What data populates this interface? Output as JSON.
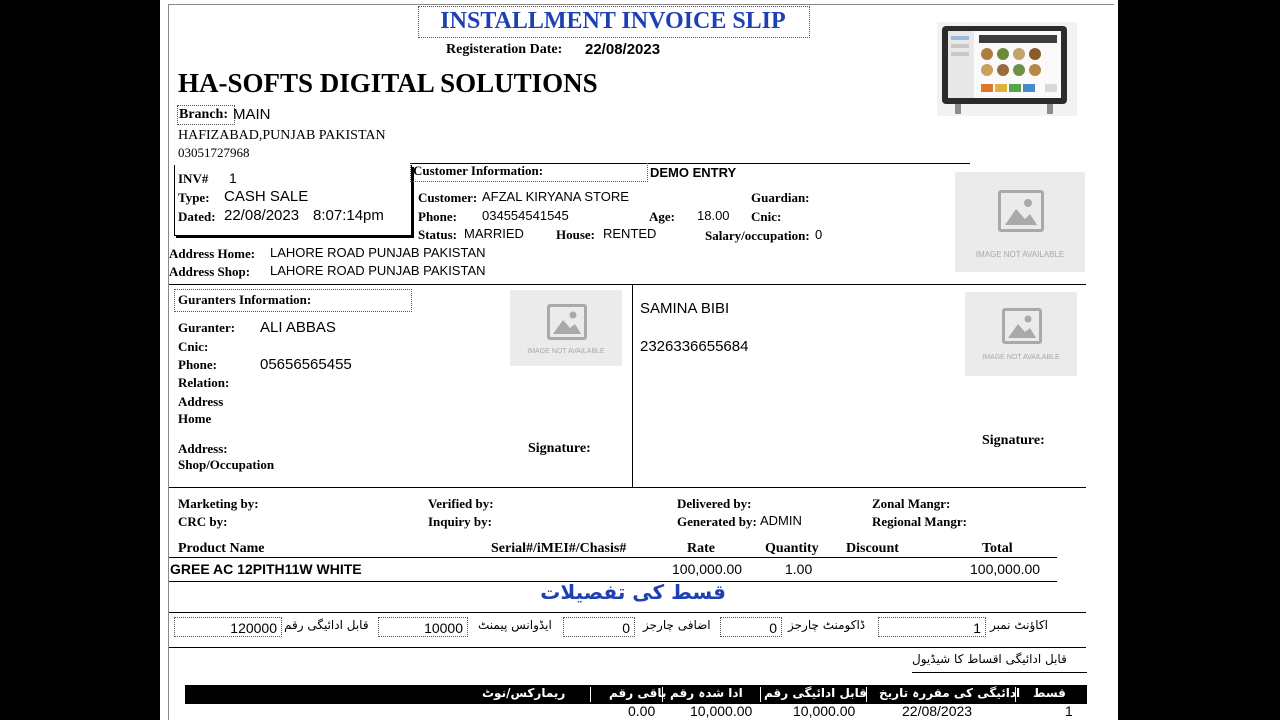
{
  "slip": {
    "title": "INSTALLMENT INVOICE SLIP",
    "reg_date_label": "Registeration Date:",
    "reg_date": "22/08/2023"
  },
  "company": {
    "name": "HA-SOFTS DIGITAL SOLUTIONS",
    "branch_label": "Branch:",
    "branch": "MAIN",
    "address": "HAFIZABAD,PUNJAB PAKISTAN",
    "phone": "03051727968"
  },
  "invoice": {
    "inv_label": "INV#",
    "inv_no": "1",
    "type_label": "Type:",
    "type": "CASH SALE",
    "dated_label": "Dated:",
    "dated": "22/08/2023",
    "time": "8:07:14pm"
  },
  "customer": {
    "section_label": "Customer Information:",
    "demo": "DEMO ENTRY",
    "customer_label": "Customer:",
    "customer": "AFZAL KIRYANA STORE",
    "phone_label": "Phone:",
    "phone": "034554541545",
    "age_label": "Age:",
    "age": "18.00",
    "status_label": "Status:",
    "status": "MARRIED",
    "house_label": "House:",
    "house": "RENTED",
    "guardian_label": "Guardian:",
    "cnic_label": "Cnic:",
    "salary_label": "Salary/occupation:",
    "salary": "0",
    "address_home_label": "Address Home:",
    "address_home": "LAHORE ROAD PUNJAB PAKISTAN",
    "address_shop_label": "Address Shop:",
    "address_shop": "LAHORE ROAD PUNJAB PAKISTAN"
  },
  "image_placeholder_text": "IMAGE NOT AVAILABLE",
  "guarantor": {
    "section_label": "Guranters Information:",
    "name_label": "Guranter:",
    "name": "ALI ABBAS",
    "cnic_label": "Cnic:",
    "phone_label": "Phone:",
    "phone": "05656565455",
    "relation_label": "Relation:",
    "address_home_label_1": "Address",
    "address_home_label_2": "Home",
    "address_shop_label_1": "Address:",
    "address_shop_label_2": "Shop/Occupation",
    "signature_label": "Signature:"
  },
  "guarantor2": {
    "name": "SAMINA BIBI",
    "cnic": "2326336655684",
    "signature_label": "Signature:"
  },
  "staff": {
    "marketing_label": "Marketing by:",
    "crc_label": "CRC by:",
    "verified_label": "Verified by:",
    "inquiry_label": "Inquiry  by:",
    "delivered_label": "Delivered by:",
    "generated_label": "Generated by:",
    "generated": "ADMIN",
    "zonal_label": "Zonal Mangr:",
    "regional_label": "Regional Mangr:"
  },
  "products": {
    "headers": [
      "Product Name",
      "Serial#/iMEI#/Chasis#",
      "Rate",
      "Quantity",
      "Discount",
      "Total"
    ],
    "rows": [
      {
        "name": "GREE AC 12PITH11W WHITE",
        "serial": "",
        "rate": "100,000.00",
        "qty": "1.00",
        "discount": "",
        "total": "100,000.00"
      }
    ]
  },
  "installment": {
    "heading": "قسط کی تفصیلات",
    "account_label": "اکاؤنٹ نمبر",
    "account": "1",
    "doc_charges_label": "ڈاکومنٹ چارجز",
    "doc_charges": "0",
    "extra_charges_label": "اضافی چارجز",
    "extra_charges": "0",
    "advance_label": "ایڈوانس پیمنٹ",
    "advance": "10000",
    "payable_label": "قابل ادائیگی رقم",
    "payable": "120000",
    "schedule_label": "قابل ادائیگی اقساط کا شیڈیول"
  },
  "schedule": {
    "headers": [
      "قسط نمبر",
      "ادائیگی کی مقررہ تاریخ",
      "قابل ادائیگی رقم",
      "ادا شدہ رقم",
      "باقی رقم",
      "ریمارکس/نوٹ"
    ],
    "rows": [
      {
        "no": "1",
        "date": "22/08/2023",
        "payable": "10,000.00",
        "paid": "10,000.00",
        "remaining": "0.00",
        "remarks": ""
      }
    ]
  }
}
